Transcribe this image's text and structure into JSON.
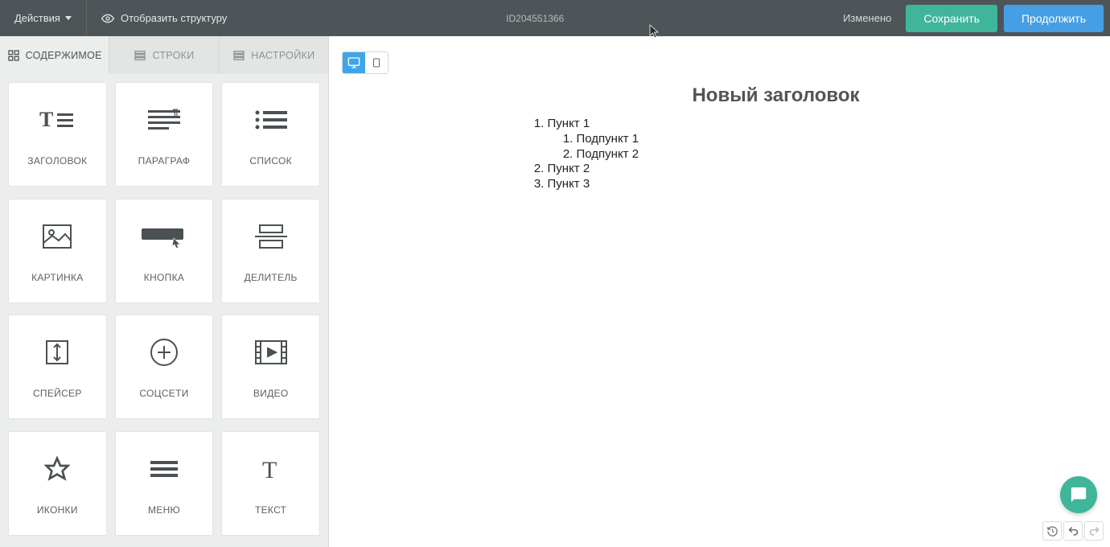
{
  "topbar": {
    "actions_label": "Действия",
    "show_structure_label": "Отобразить структуру",
    "doc_id": "ID204551366",
    "status_label": "Изменено",
    "save_label": "Сохранить",
    "continue_label": "Продолжить"
  },
  "tabs": {
    "content": "СОДЕРЖИМОЕ",
    "rows": "СТРОКИ",
    "settings": "НАСТРОЙКИ"
  },
  "blocks": [
    {
      "key": "heading",
      "label": "ЗАГОЛОВОК"
    },
    {
      "key": "paragraph",
      "label": "ПАРАГРАФ"
    },
    {
      "key": "list",
      "label": "СПИСОК"
    },
    {
      "key": "image",
      "label": "КАРТИНКА"
    },
    {
      "key": "button",
      "label": "КНОПКА"
    },
    {
      "key": "divider",
      "label": "ДЕЛИТЕЛЬ"
    },
    {
      "key": "spacer",
      "label": "СПЕЙСЕР"
    },
    {
      "key": "social",
      "label": "СОЦСЕТИ"
    },
    {
      "key": "video",
      "label": "ВИДЕО"
    },
    {
      "key": "icons",
      "label": "ИКОНКИ"
    },
    {
      "key": "menu",
      "label": "МЕНЮ"
    },
    {
      "key": "text",
      "label": "ТЕКСТ"
    }
  ],
  "canvas": {
    "title": "Новый заголовок",
    "list": {
      "items": [
        {
          "text": "Пункт 1",
          "children": [
            {
              "text": "Подпункт 1"
            },
            {
              "text": "Подпункт 2"
            }
          ]
        },
        {
          "text": "Пункт 2"
        },
        {
          "text": "Пункт 3"
        }
      ]
    }
  },
  "colors": {
    "accent_green": "#3fb59a",
    "accent_blue": "#469ee5",
    "topbar_bg": "#4e5558"
  }
}
